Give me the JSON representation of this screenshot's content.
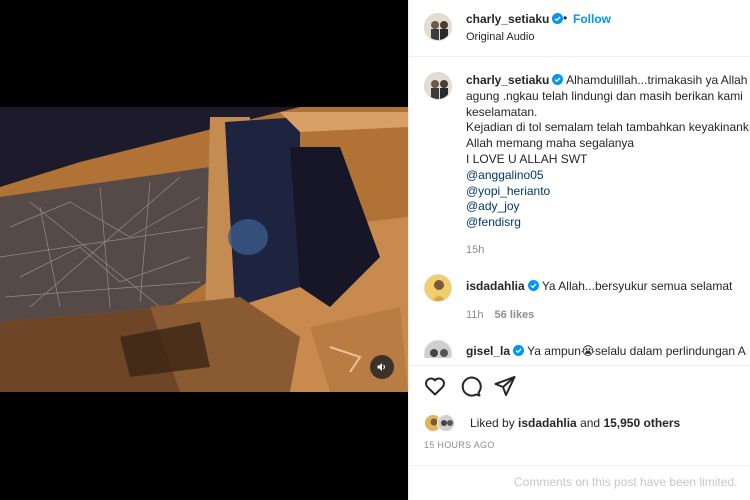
{
  "post": {
    "author": "charly_setiaku",
    "follow_label": "Follow",
    "separator": "•",
    "audio_label": "Original Audio"
  },
  "caption": {
    "username": "charly_setiaku",
    "lines": [
      "Alhamdulillah...trimakasih ya Allah y",
      "agung .ngkau telah lindungi dan masih berikan kami",
      "keselamatan.",
      "Kejadian di tol semalam telah tambahkan keyakinank",
      "Allah memang maha segalanya",
      "I LOVE U ALLAH SWT"
    ],
    "mentions": [
      "@anggalino05",
      "@yopi_herianto",
      "@ady_joy",
      "@fendisrg"
    ],
    "time": "15h"
  },
  "comments": [
    {
      "username": "isdadahlia",
      "text": "Ya Allah...bersyukur semua selamat",
      "time": "11h",
      "likes": "56 likes"
    },
    {
      "username": "gisel_la",
      "text": "Ya ampun😭selalu dalam perlindungan A"
    }
  ],
  "liked_by": {
    "prefix": "Liked by",
    "user": "isdadahlia",
    "middle": "and",
    "others": "15,950 others"
  },
  "timestamp": "15 HOURS AGO",
  "comments_limited": "Comments on this post have been limited.",
  "icons": {
    "verified": "verified-badge-icon",
    "like": "heart-icon",
    "comment": "comment-icon",
    "share": "share-icon",
    "mute": "speaker-icon"
  },
  "colors": {
    "accent": "#0095f6",
    "verified": "#0095f6",
    "secondary_text": "#8e8e8e",
    "mention": "#00376b"
  }
}
